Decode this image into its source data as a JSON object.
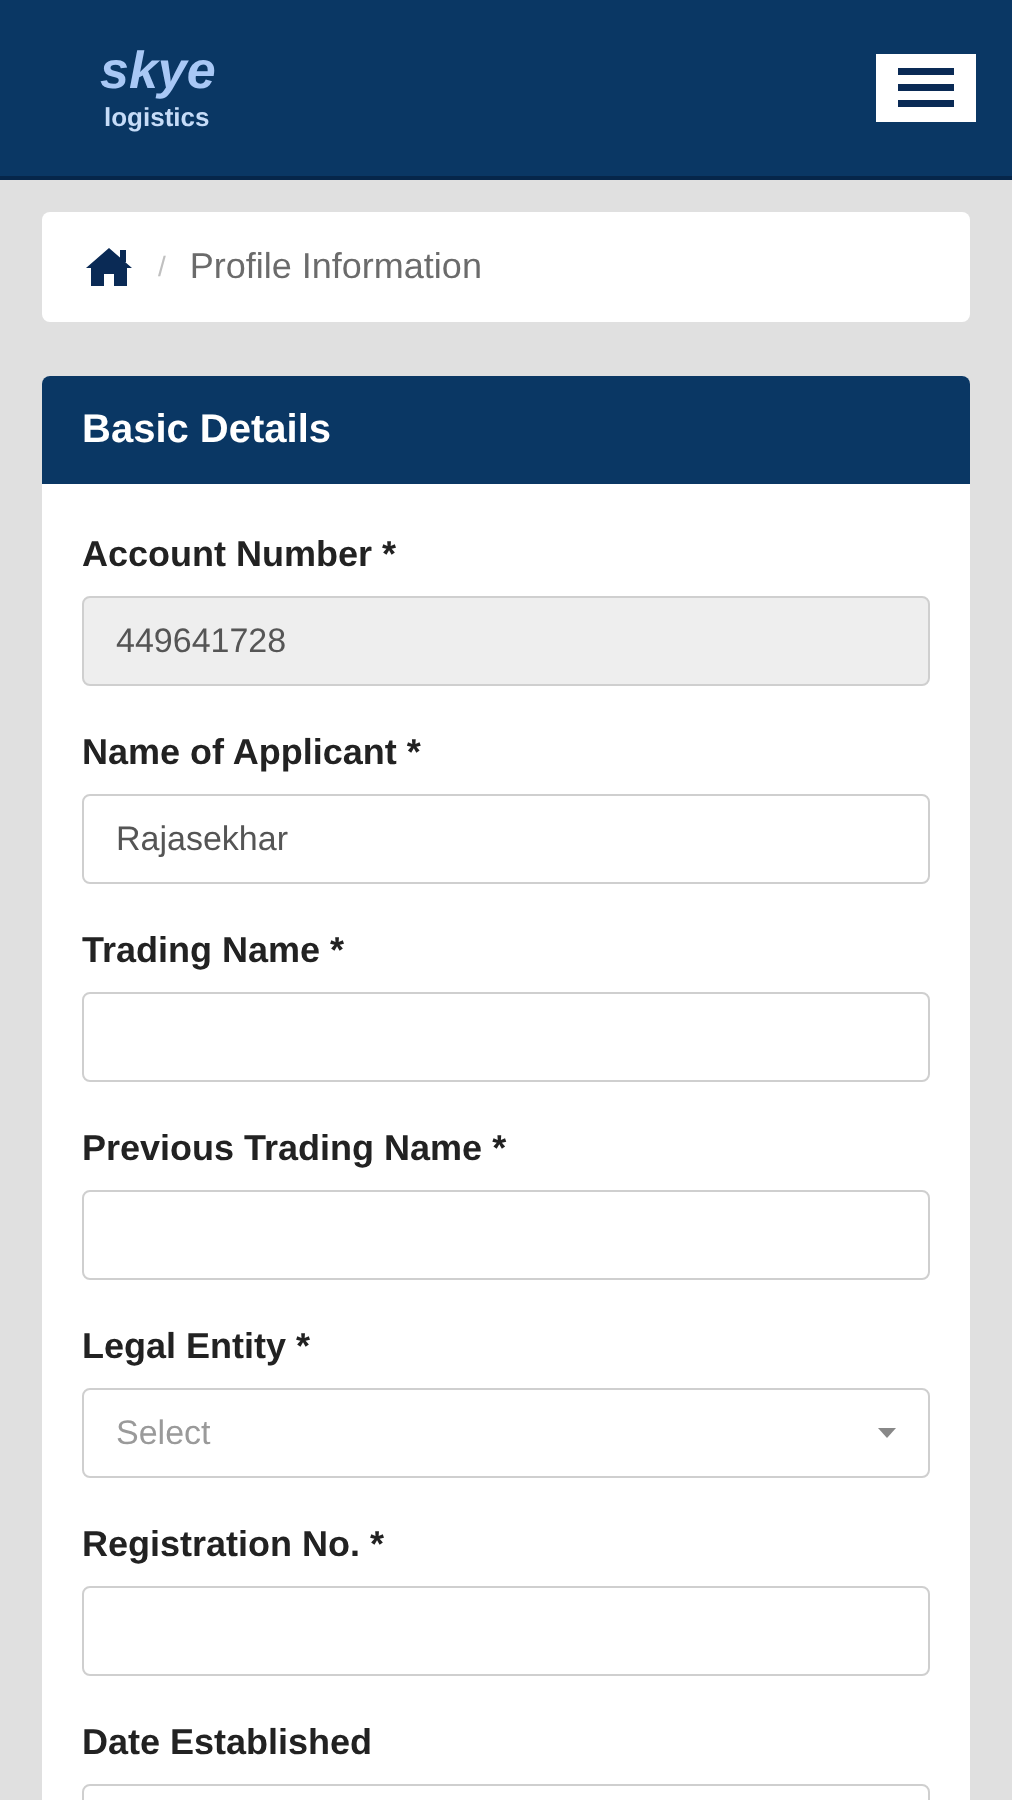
{
  "header": {
    "logo_title": "skye",
    "logo_subtitle": "logistics"
  },
  "breadcrumb": {
    "current": "Profile Information",
    "separator": "/"
  },
  "panel": {
    "title": "Basic Details"
  },
  "fields": [
    {
      "label": "Account Number *",
      "kind": "text",
      "value": "449641728",
      "disabled": true
    },
    {
      "label": "Name of Applicant *",
      "kind": "text",
      "value": "Rajasekhar",
      "disabled": false
    },
    {
      "label": "Trading Name *",
      "kind": "text",
      "disabled": false
    },
    {
      "label": "Previous Trading Name *",
      "kind": "text",
      "disabled": false
    },
    {
      "label": "Legal Entity *",
      "kind": "select",
      "placeholder": "Select",
      "disabled": false
    },
    {
      "label": "Registration No. *",
      "kind": "text",
      "disabled": false
    },
    {
      "label": "Date Established",
      "kind": "text",
      "disabled": false
    }
  ]
}
